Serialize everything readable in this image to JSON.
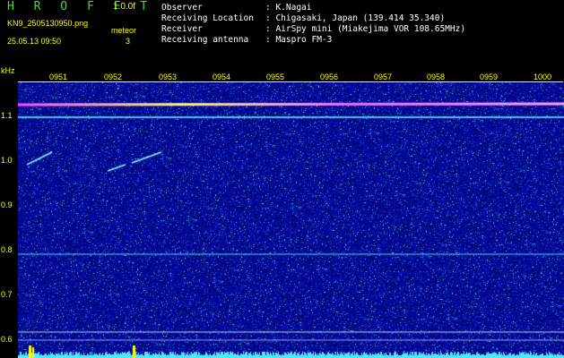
{
  "header": {
    "app_title": "H R O F F T",
    "version": "1.0.0f",
    "filename": "KN9_2505130950.png",
    "datetime": "25.05.13 09:50",
    "counter_label": "meteor",
    "counter_value": "3"
  },
  "info": [
    {
      "label": "Observer",
      "value": ": K.Nagai"
    },
    {
      "label": "Receiving Location",
      "value": ": Chigasaki, Japan (139.414 35.340)"
    },
    {
      "label": "Receiver",
      "value": ": AirSpy mini (Miakejima VOR 108.65MHz)"
    },
    {
      "label": "Receiving antenna",
      "value": ": Maspro FM-3"
    }
  ],
  "spectrogram": {
    "y_unit": "kHz",
    "y_ticks": [
      "1.1",
      "1.0",
      "0.9",
      "0.8",
      "0.7",
      "0.6"
    ],
    "x_ticks": [
      "0951",
      "0952",
      "0953",
      "0954",
      "0955",
      "0956",
      "0957",
      "0958",
      "0959",
      "1000"
    ],
    "colors": {
      "background": "#05088f",
      "axis": "#ffff00",
      "signal": "#60ffff"
    }
  }
}
